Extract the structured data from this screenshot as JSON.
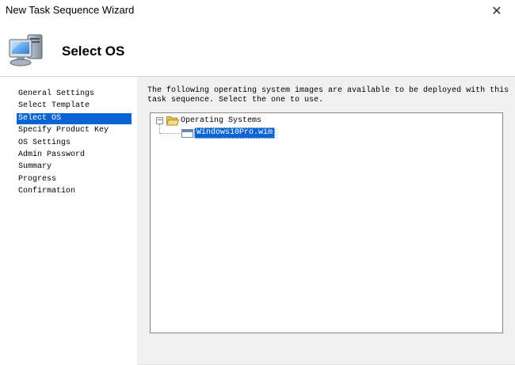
{
  "window": {
    "title": "New Task Sequence Wizard",
    "close_glyph": "✕"
  },
  "header": {
    "title": "Select OS",
    "icon": "computer-icon"
  },
  "nav": {
    "items": [
      {
        "label": "General Settings"
      },
      {
        "label": "Select Template"
      },
      {
        "label": "Select OS"
      },
      {
        "label": "Specify Product Key"
      },
      {
        "label": "OS Settings"
      },
      {
        "label": "Admin Password"
      },
      {
        "label": "Summary"
      },
      {
        "label": "Progress"
      },
      {
        "label": "Confirmation"
      }
    ],
    "selected_index": 2
  },
  "main": {
    "instructions_line1": "The following operating system images are available to be deployed with this",
    "instructions_line2": "task sequence.  Select the one to use."
  },
  "tree": {
    "expander_glyph": "−",
    "root_label": "Operating Systems",
    "child_label": "Windows10Pro.wim"
  },
  "colors": {
    "selection": "#0a64d2",
    "panel_bg": "#f0f0f0",
    "tree_border": "#828790"
  }
}
